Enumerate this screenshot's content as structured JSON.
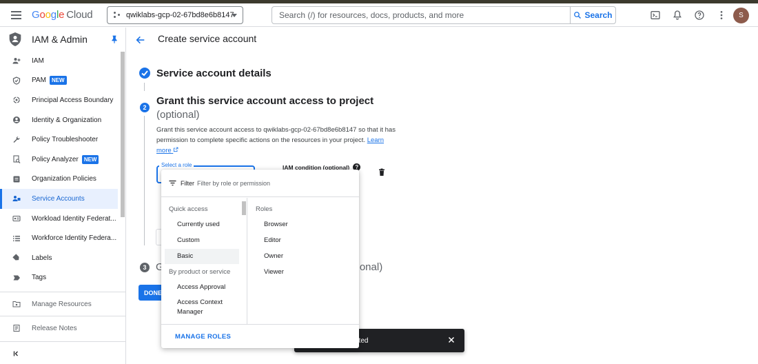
{
  "header": {
    "logo_google": "Google",
    "logo_cloud": "Cloud",
    "project": "qwiklabs-gcp-02-67bd8e6b8147",
    "search_placeholder": "Search (/) for resources, docs, products, and more",
    "search_button": "Search",
    "avatar_initial": "S"
  },
  "sidebar": {
    "title": "IAM & Admin",
    "items": [
      {
        "label": "IAM",
        "icon": "person-add-icon"
      },
      {
        "label": "PAM",
        "icon": "shield-check-icon",
        "badge": "NEW"
      },
      {
        "label": "Principal Access Boundary",
        "icon": "boundary-icon"
      },
      {
        "label": "Identity & Organization",
        "icon": "account-circle-icon"
      },
      {
        "label": "Policy Troubleshooter",
        "icon": "wrench-icon"
      },
      {
        "label": "Policy Analyzer",
        "icon": "analyzer-icon",
        "badge": "NEW"
      },
      {
        "label": "Organization Policies",
        "icon": "document-icon"
      },
      {
        "label": "Service Accounts",
        "icon": "service-account-icon",
        "active": true
      },
      {
        "label": "Workload Identity Federat...",
        "icon": "id-card-icon"
      },
      {
        "label": "Workforce Identity Federa...",
        "icon": "list-icon"
      },
      {
        "label": "Labels",
        "icon": "label-icon"
      },
      {
        "label": "Tags",
        "icon": "tag-icon"
      }
    ],
    "manage_resources": "Manage Resources",
    "release_notes": "Release Notes"
  },
  "main": {
    "page_title": "Create service account",
    "step1_title": "Service account details",
    "step2_number": "2",
    "step2_title": "Grant this service account access to project",
    "step2_optional": "(optional)",
    "step2_desc": "Grant this service account access to qwiklabs-gcp-02-67bd8e6b8147 so that it has permission to complete specific actions on the resources in your project.",
    "learn_more": "Learn more",
    "role_label": "Select a role",
    "iam_condition": "IAM condition (optional)",
    "help": "?",
    "step3_number": "3",
    "step3_title_start": "G",
    "step3_optional_tail": "ptional)",
    "done_button": "DONE"
  },
  "dropdown": {
    "filter_label": "Filter",
    "filter_placeholder": "Filter by role or permission",
    "quick_access": "Quick access",
    "quick_items": [
      "Currently used",
      "Custom",
      "Basic"
    ],
    "by_product": "By product or service",
    "product_items": [
      "Access Approval",
      "Access Context Manager"
    ],
    "roles_head": "Roles",
    "roles": [
      "Browser",
      "Editor",
      "Owner",
      "Viewer"
    ],
    "manage_roles": "MANAGE ROLES"
  },
  "snackbar": {
    "text": "ated"
  },
  "colors": {
    "accent": "#1a73e8",
    "active_bg": "#e8f0fe"
  }
}
